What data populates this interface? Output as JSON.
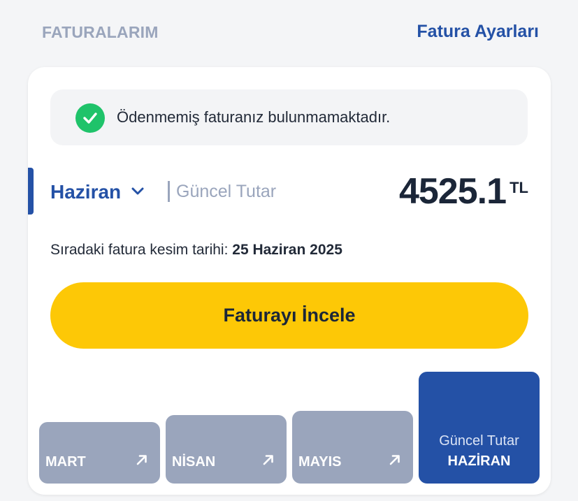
{
  "header": {
    "title": "FATURALARIM",
    "settings_link": "Fatura Ayarları"
  },
  "notice": {
    "icon": "check-circle-icon",
    "text": "Ödenmemiş faturanız bulunmamaktadır."
  },
  "bill": {
    "selected_month": "Haziran",
    "current_label": "Güncel Tutar",
    "amount": "4525.1",
    "currency": "TL",
    "due_label": "Sıradaki fatura kesim tarihi: ",
    "due_date": "25 Haziran 2025",
    "review_button": "Faturayı İncele"
  },
  "months": [
    {
      "name": "MART",
      "height_fraction": 0.55
    },
    {
      "name": "NİSAN",
      "height_fraction": 0.61
    },
    {
      "name": "MAYIS",
      "height_fraction": 0.65
    }
  ],
  "current_month_tile": {
    "sub_label": "Güncel Tutar",
    "name": "HAZİRAN"
  },
  "colors": {
    "accent": "#2451a6",
    "muted": "#9aa5bc",
    "button": "#fdc806",
    "success": "#1fc36a"
  }
}
